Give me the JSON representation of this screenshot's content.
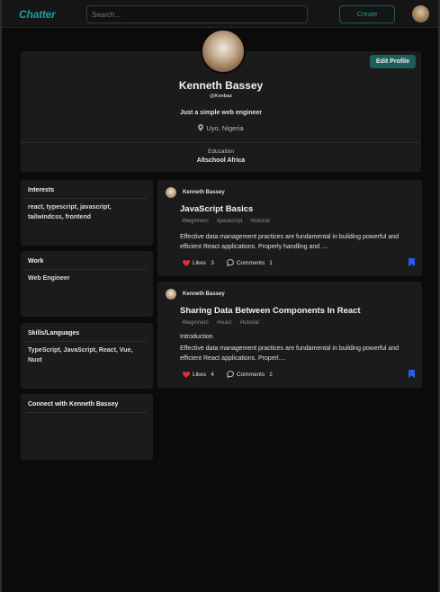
{
  "navbar": {
    "logo": "Chatter",
    "search_placeholder": "Search...",
    "create_label": "Create"
  },
  "profile": {
    "edit_label": "Edit Profile",
    "name": "Kenneth Bassey",
    "handle": "@Kenbaz",
    "bio": "Just a simple web engineer",
    "location": "Uyo, Nigeria",
    "education_label": "Education",
    "education": "Altschool Africa"
  },
  "sidebar": {
    "interests": {
      "title": "Interests",
      "body": "react, typescript, javascript, tailwindcss, frontend"
    },
    "work": {
      "title": "Work",
      "body": "Web Engineer"
    },
    "skills": {
      "title": "Skills/Languages",
      "body": "TypeScript, JavaScript, React, Vue, Nuxt"
    },
    "connect": {
      "title": "Connect with Kenneth Bassey"
    }
  },
  "posts": [
    {
      "author": "Kenneth Bassey",
      "title": "JavaScript Basics",
      "tags": [
        "#beginners",
        "#javascript",
        "#tutorial"
      ],
      "intro": "",
      "excerpt": "Effective data management practices are fundamental in building powerful and efficient React applications. Properly handling and ....",
      "likes_label": "Likes",
      "likes": "3",
      "comments_label": "Comments",
      "comments": "1"
    },
    {
      "author": "Kenneth Bassey",
      "title": "Sharing Data Between Components In React",
      "tags": [
        "#beginners",
        "#react",
        "#tutorial"
      ],
      "intro": "Introduction",
      "excerpt": "Effective data management practices are fundamental in building powerful and efficient React applications. Properl....",
      "likes_label": "Likes",
      "likes": "4",
      "comments_label": "Comments",
      "comments": "2"
    }
  ],
  "colors": {
    "accent": "#1e5e5a",
    "logo": "#1e9c9c",
    "like_heart": "#e03131",
    "bookmark": "#2b5ce6"
  },
  "icons": {
    "location": "map-pin-icon",
    "like": "heart-icon",
    "comment": "chat-bubble-icon",
    "bookmark": "bookmark-icon"
  }
}
